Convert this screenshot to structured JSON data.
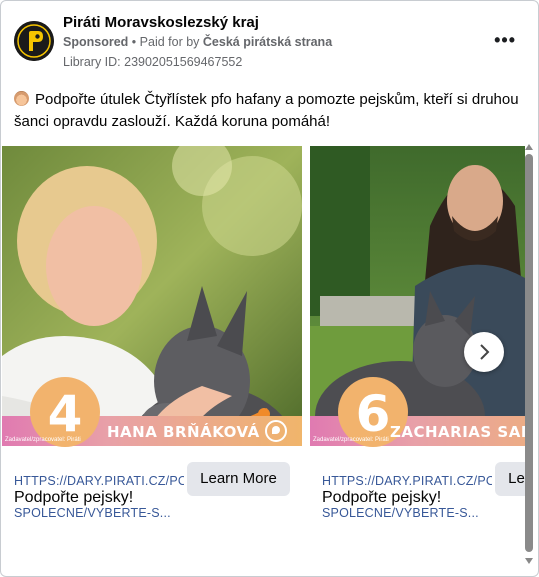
{
  "header": {
    "page_name": "Piráti Moravskoslezský kraj",
    "sponsored": "Sponsored",
    "paid_for_prefix": "Paid for by",
    "payer": "Česká pirátská strana",
    "separator": "•",
    "library_id": "Library ID: 23902051569467552",
    "more_label": "•••"
  },
  "post": {
    "text": "Podpořte útulek Čtyřlístek pfo hafany a pomozte pejskům, kteří si druhou šanci opravdu zaslouží. Každá koruna pomáhá!"
  },
  "slides": [
    {
      "number": "4",
      "name": "HANA BRŇÁKOVÁ",
      "tiny_note": "Zadavatel/zpracovatel: Piráti",
      "link": "HTTPS://DARY.PIRATI.CZ/POMOZTE-SPOLECNE/VYBERTE-S...",
      "link_line1": "HTTPS://DARY.PIRATI.CZ/POM/",
      "link_line2": "SPOLECNE/VYBERTE-S...",
      "title": "Podpořte pejsky!",
      "cta": "Learn More"
    },
    {
      "number": "6",
      "name": "ZACHARIAS SAMUEL FISC",
      "tiny_note": "Zadavatel/zpracovatel: Piráti",
      "link_line1": "HTTPS://DARY.PIRATI.CZ/POM/",
      "link_line2": "SPOLECNE/VYBERTE-S...",
      "title": "Podpořte pejsky!",
      "cta": "Learn More"
    }
  ],
  "colors": {
    "link": "#385898",
    "band_start": "#e07ab1",
    "band_end": "#f0b56b",
    "number_circle": "#f2b36d",
    "button_bg": "#e4e6eb",
    "pirate_logo_bg": "#1a1a1a",
    "pirate_logo_fg": "#f5c400"
  },
  "icons": {
    "more": "more-horizontal-icon",
    "next": "chevron-right-icon",
    "post_emoji": "dog-face-icon",
    "page_logo": "pirate-party-logo"
  }
}
